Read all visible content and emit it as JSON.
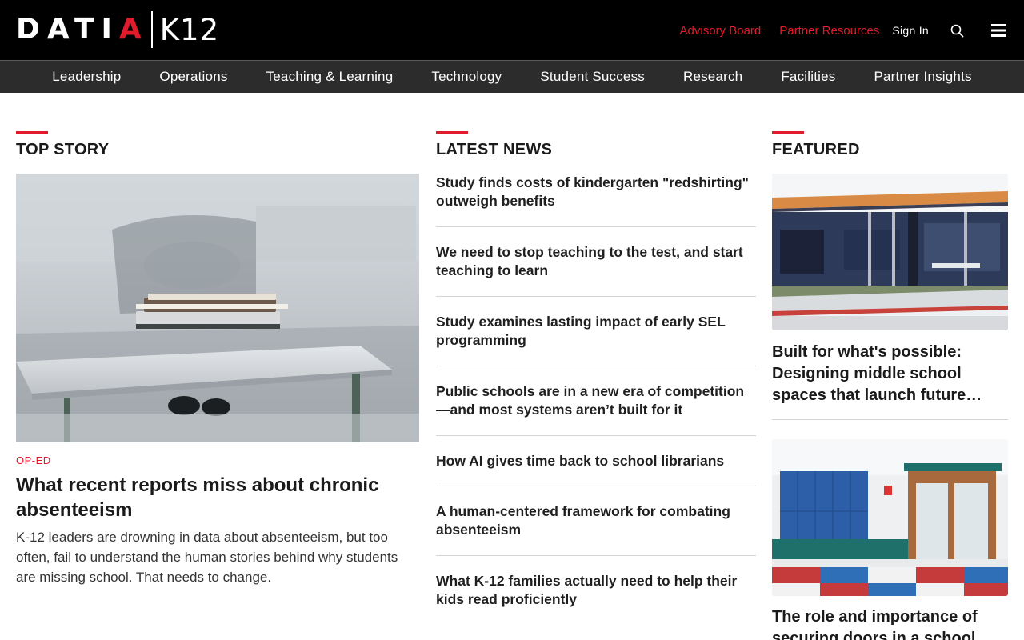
{
  "brand": {
    "logo_word": "DATIA",
    "logo_k12": "K12"
  },
  "header": {
    "advisory_board": "Advisory Board",
    "partner_resources": "Partner Resources",
    "sign_in": "Sign In"
  },
  "categories": [
    "Leadership",
    "Operations",
    "Teaching & Learning",
    "Technology",
    "Student Success",
    "Research",
    "Facilities",
    "Partner Insights"
  ],
  "top_story": {
    "section_title": "TOP STORY",
    "tag": "OP-ED",
    "headline": "What recent reports miss about chronic absenteeism",
    "summary": "K-12 leaders are drowning in data about absenteeism, but too often, fail to understand the human stories behind why students are missing school. That needs to change."
  },
  "latest_news": {
    "section_title": "LATEST NEWS",
    "items": [
      "Study finds costs of kindergarten \"redshirting\" outweigh benefits",
      "We need to stop teaching to the test, and start teaching to learn",
      "Study examines lasting impact of early SEL programming",
      "Public schools are in a new era of competition—and most systems aren’t built for it",
      "How AI gives time back to school librarians",
      "A human-centered framework for combating absenteeism",
      "What K-12 families actually need to help their kids read proficiently"
    ]
  },
  "featured": {
    "section_title": "FEATURED",
    "items": [
      {
        "title": "Built for what's possible: Designing middle school spaces that launch future…"
      },
      {
        "title": "The role and importance of securing doors in a school"
      }
    ]
  },
  "colors": {
    "accent": "#e21b2c",
    "header_bg": "#000000",
    "nav_bg": "#2c2c2c"
  },
  "icons": [
    "search-icon",
    "hamburger-menu-icon"
  ]
}
